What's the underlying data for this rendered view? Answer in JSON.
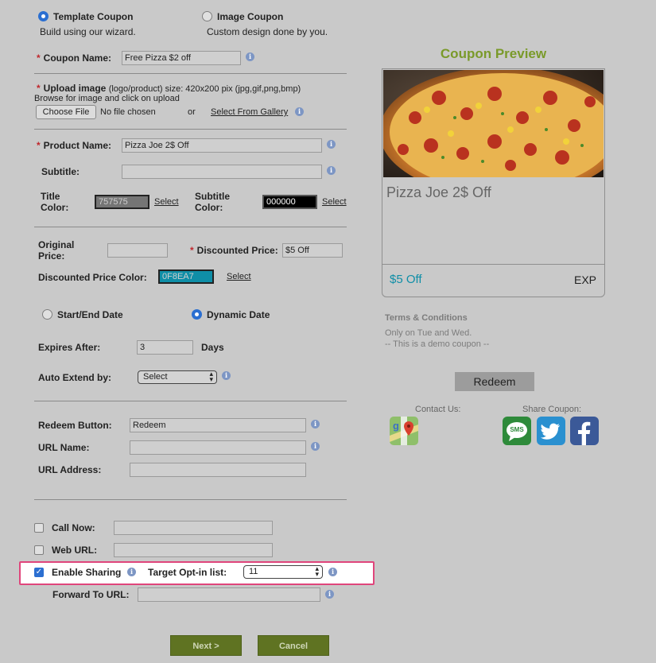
{
  "coupon_type": {
    "template": {
      "label": "Template Coupon",
      "desc": "Build using our wizard."
    },
    "image": {
      "label": "Image Coupon",
      "desc": "Custom design done by you."
    }
  },
  "coupon_name": {
    "label": "Coupon Name:",
    "value": "Free Pizza $2 off"
  },
  "upload": {
    "label": "Upload image",
    "hint": "(logo/product) size: 420x200 pix (jpg,gif,png,bmp)",
    "browse_text": "Browse for image and click on upload",
    "choose_file": "Choose File",
    "no_file": "No file chosen",
    "or": "or",
    "gallery_link": "Select From Gallery"
  },
  "product_name": {
    "label": "Product Name:",
    "value": "Pizza Joe 2$ Off"
  },
  "subtitle": {
    "label": "Subtitle:",
    "value": ""
  },
  "title_color": {
    "label_line1": "Title",
    "label_line2": "Color:",
    "value": "757575",
    "select": "Select"
  },
  "subtitle_color": {
    "label_line1": "Subtitle",
    "label_line2": "Color:",
    "value": "000000",
    "select": "Select"
  },
  "original_price": {
    "label_line1": "Original",
    "label_line2": "Price:",
    "value": ""
  },
  "discounted_price": {
    "label": "Discounted Price:",
    "value": "$5 Off"
  },
  "discounted_price_color": {
    "label": "Discounted Price Color:",
    "value": "0F8EA7",
    "select": "Select"
  },
  "date_mode": {
    "start_end": "Start/End Date",
    "dynamic": "Dynamic Date"
  },
  "expires_after": {
    "label": "Expires After:",
    "value": "3",
    "unit": "Days"
  },
  "auto_extend": {
    "label": "Auto Extend by:",
    "value": "Select"
  },
  "redeem_button": {
    "label": "Redeem Button:",
    "value": "Redeem"
  },
  "url_name": {
    "label": "URL Name:",
    "value": ""
  },
  "url_address": {
    "label": "URL Address:",
    "value": ""
  },
  "call_now": {
    "label": "Call Now:",
    "value": ""
  },
  "web_url": {
    "label": "Web URL:",
    "value": ""
  },
  "enable_sharing": {
    "label": "Enable Sharing",
    "target_label": "Target Opt-in list:",
    "target_value": "11"
  },
  "forward_url": {
    "label": "Forward To URL:",
    "value": ""
  },
  "actions": {
    "next": "Next >",
    "cancel": "Cancel"
  },
  "preview": {
    "heading": "Coupon Preview",
    "title": "Pizza Joe 2$ Off",
    "price": "$5 Off",
    "exp": "EXP",
    "terms_heading": "Terms & Conditions",
    "terms_line1": "Only on Tue and Wed.",
    "terms_line2": "-- This is a demo coupon --",
    "redeem": "Redeem",
    "contact_us": "Contact Us:",
    "share_coupon": "Share Coupon:",
    "sms": "SMS"
  },
  "colors": {
    "accent_green": "#7a9a2a",
    "button_green": "#5f7322",
    "price_color": "#0F8EA7",
    "title_color": "#757575",
    "highlight": "#e0457b"
  }
}
